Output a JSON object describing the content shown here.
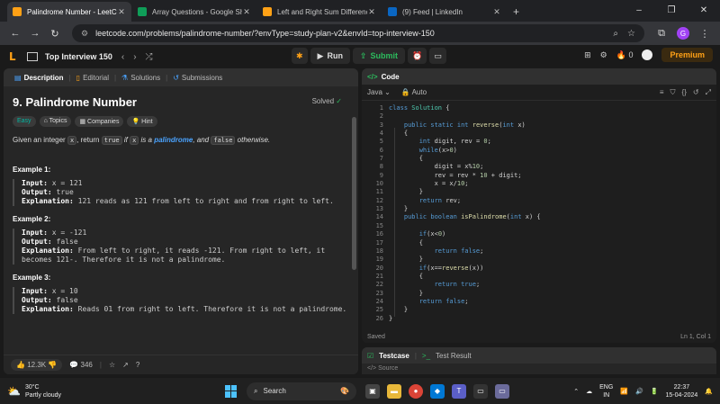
{
  "browser": {
    "tabs": [
      {
        "title": "Palindrome Number - LeetCode",
        "icon": "leetcode-icon",
        "color": "#ffa116",
        "active": true
      },
      {
        "title": "Array Questions - Google Sheets",
        "icon": "sheets-icon",
        "color": "#0f9d58",
        "active": false
      },
      {
        "title": "Left and Right Sum Differences",
        "icon": "leetcode-icon",
        "color": "#ffa116",
        "active": false
      },
      {
        "title": "(9) Feed | LinkedIn",
        "icon": "linkedin-icon",
        "color": "#0a66c2",
        "active": false
      }
    ],
    "url": "leetcode.com/problems/palindrome-number/?envType=study-plan-v2&envId=top-interview-150",
    "profile_initial": "G"
  },
  "lc_header": {
    "list_title": "Top Interview 150",
    "run_label": "Run",
    "submit_label": "Submit",
    "streak": "0",
    "premium_label": "Premium"
  },
  "left_tabs": [
    "Description",
    "Editorial",
    "Solutions",
    "Submissions"
  ],
  "problem": {
    "title": "9. Palindrome Number",
    "status": "Solved",
    "difficulty": "Easy",
    "chips": [
      "Topics",
      "Companies",
      "Hint"
    ],
    "desc_pre": "Given an integer",
    "desc_x": "x",
    "desc_mid": ", return",
    "desc_true": "true",
    "desc_if": "if",
    "desc_x2": "x",
    "desc_is": "is a",
    "desc_link": "palindrome",
    "desc_and": ", and",
    "desc_false": "false",
    "desc_end": "otherwise.",
    "examples": [
      {
        "heading": "Example 1:",
        "input": "x = 121",
        "output": "true",
        "explanation": "121 reads as 121 from left to right and from right to left."
      },
      {
        "heading": "Example 2:",
        "input": "x = -121",
        "output": "false",
        "explanation": "From left to right, it reads -121. From right to left, it becomes 121-. Therefore it is not a palindrome."
      },
      {
        "heading": "Example 3:",
        "input": "x = 10",
        "output": "false",
        "explanation": "Reads 01 from right to left. Therefore it is not a palindrome."
      }
    ],
    "labels": {
      "input": "Input:",
      "output": "Output:",
      "explanation": "Explanation:"
    },
    "likes": "12.3K",
    "comments": "346"
  },
  "code_panel": {
    "title": "Code",
    "language": "Java",
    "mode": "Auto",
    "status_left": "Saved",
    "status_right": "Ln 1, Col 1",
    "line_numbers": [
      "1",
      "2",
      "3",
      "4",
      "5",
      "6",
      "7",
      "8",
      "9",
      "10",
      "11",
      "12",
      "13",
      "14",
      "15",
      "16",
      "17",
      "18",
      "19",
      "20",
      "21",
      "22",
      "23",
      "24",
      "25",
      "26"
    ]
  },
  "test_panel": {
    "tab1": "Testcase",
    "tab2": "Test Result",
    "source": "Source"
  },
  "taskbar": {
    "temp": "30°C",
    "weather": "Partly cloudy",
    "search": "Search",
    "lang1": "ENG",
    "lang2": "IN",
    "time": "22:37",
    "date": "15-04-2024"
  }
}
